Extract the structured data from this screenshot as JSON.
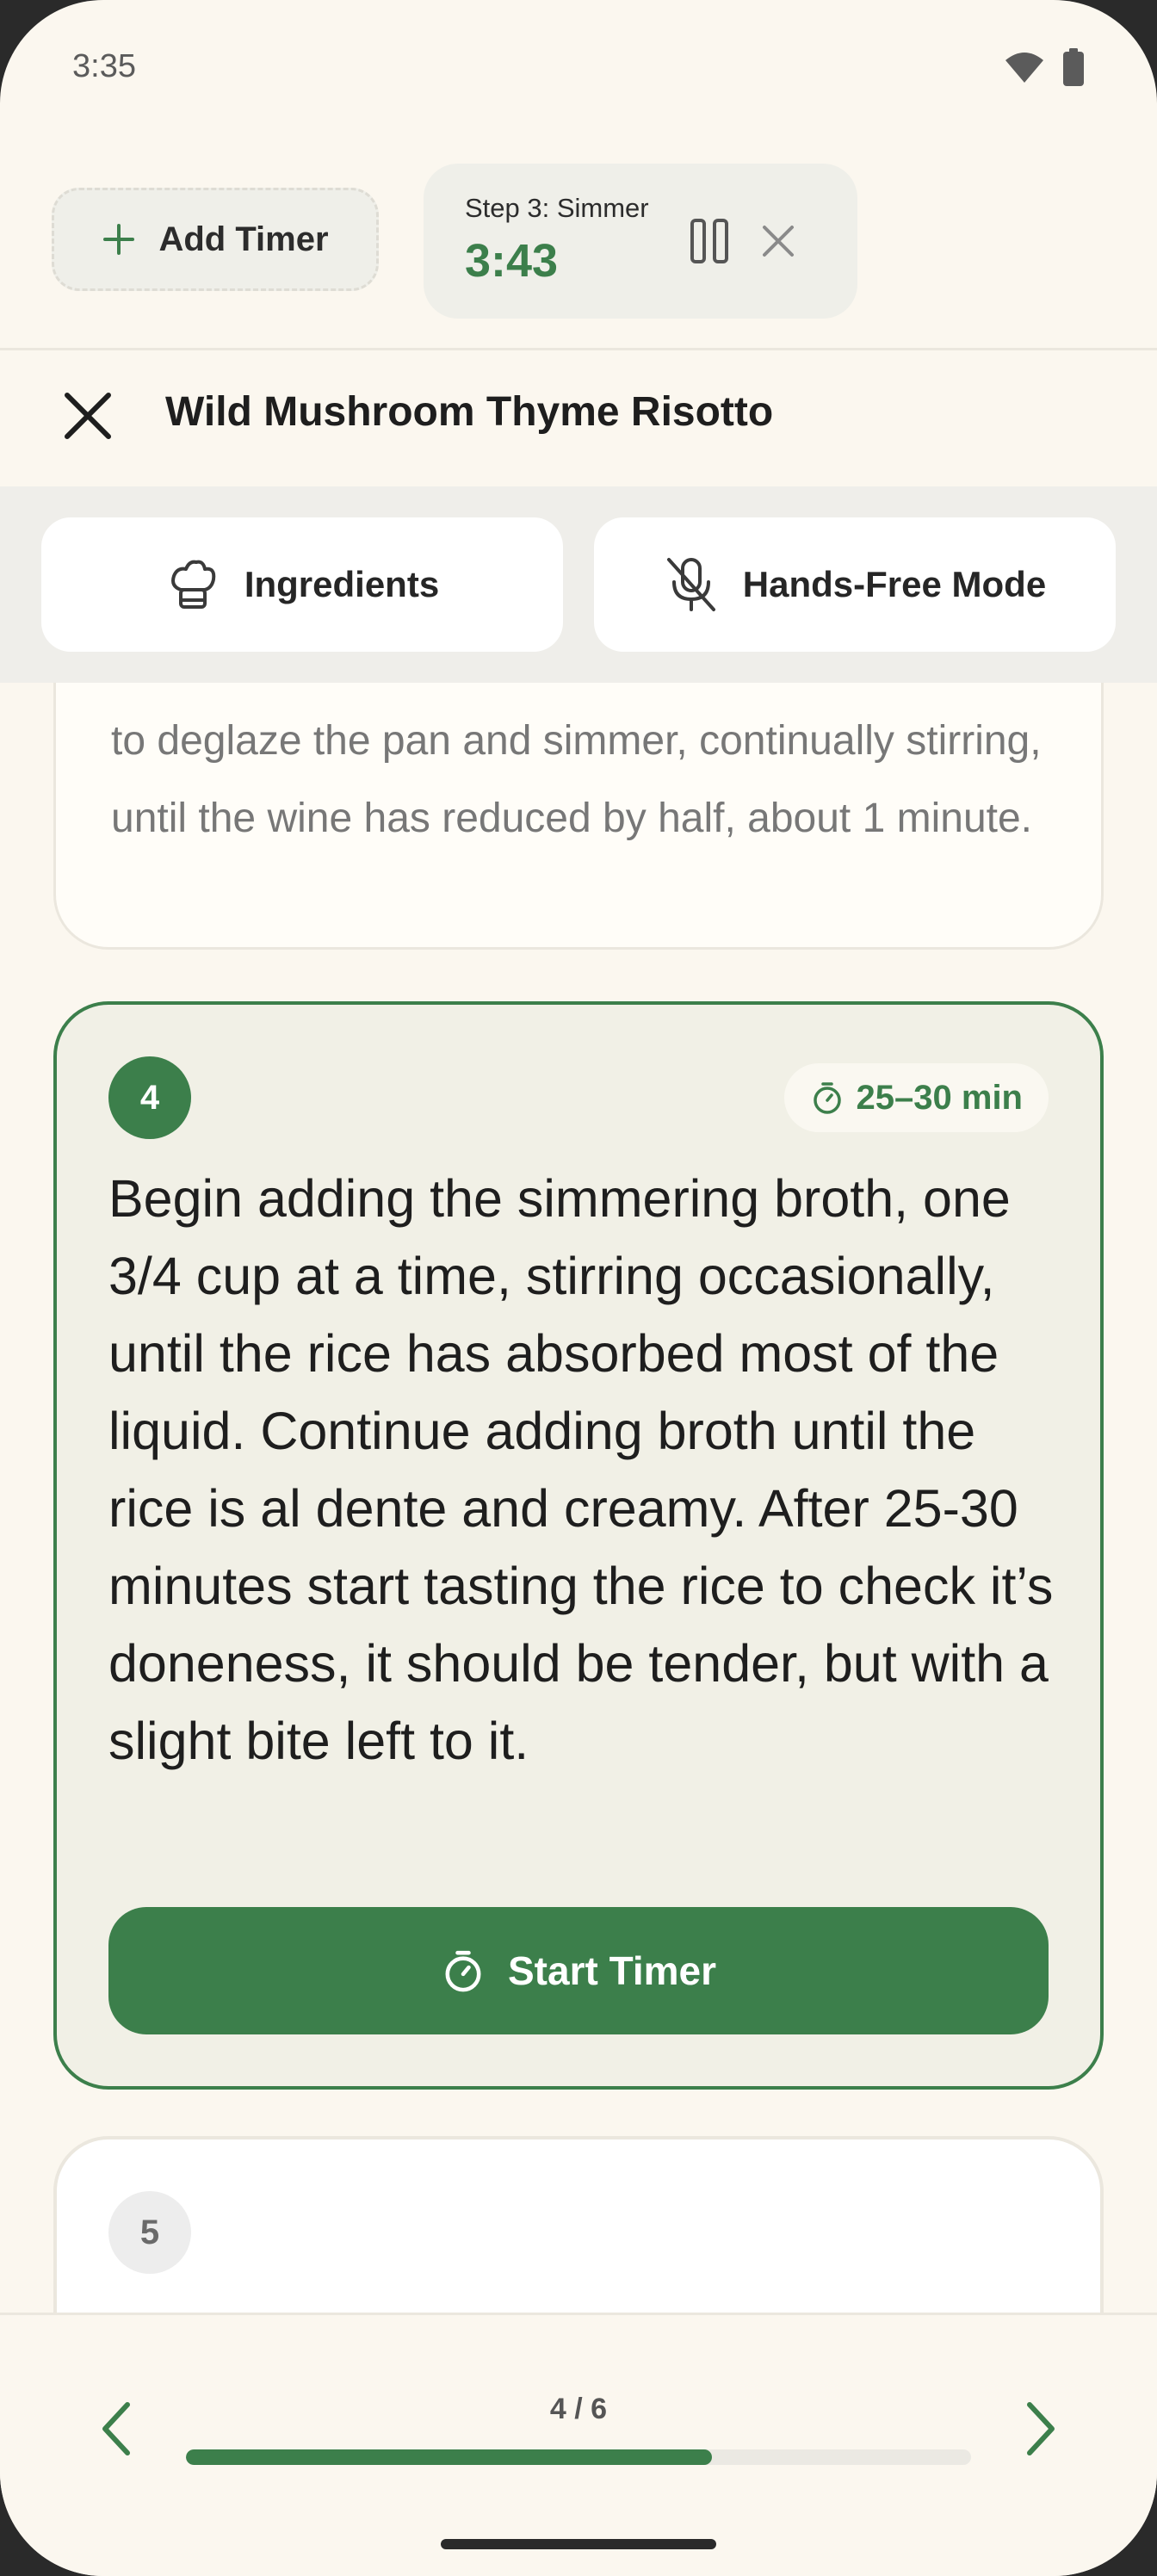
{
  "status_bar": {
    "time": "3:35",
    "icons": [
      "wifi-icon",
      "battery-icon"
    ]
  },
  "timer_bar": {
    "add_timer_label": "Add Timer",
    "running_timer": {
      "title": "Step 3: Simmer",
      "time": "3:43"
    }
  },
  "header": {
    "title": "Wild Mushroom Thyme Risotto"
  },
  "tabs": [
    {
      "label": "Ingredients",
      "icon": "chef-hat-icon"
    },
    {
      "label": "Hands-Free Mode",
      "icon": "mic-off-icon"
    }
  ],
  "steps": {
    "previous": {
      "text": "to deglaze the pan and simmer, continually stirring, until the wine has reduced by half, about 1 minute."
    },
    "current": {
      "number": "4",
      "duration": "25–30 min",
      "text": "Begin adding the simmering broth, one 3/4 cup at a time, stirring occasionally, until the rice has absorbed most of the liquid. Continue adding broth until the rice is al dente and creamy. After 25-30 minutes start tasting the rice to check it’s doneness, it should be tender, but with a slight bite left to it.",
      "start_timer_label": "Start Timer"
    },
    "next": {
      "number": "5"
    }
  },
  "navigation": {
    "progress_label": "4 / 6",
    "progress_fraction": 0.67
  },
  "colors": {
    "accent": "#3c7f4b",
    "background": "#fbf7ef",
    "card_active": "#f1f0e6"
  }
}
